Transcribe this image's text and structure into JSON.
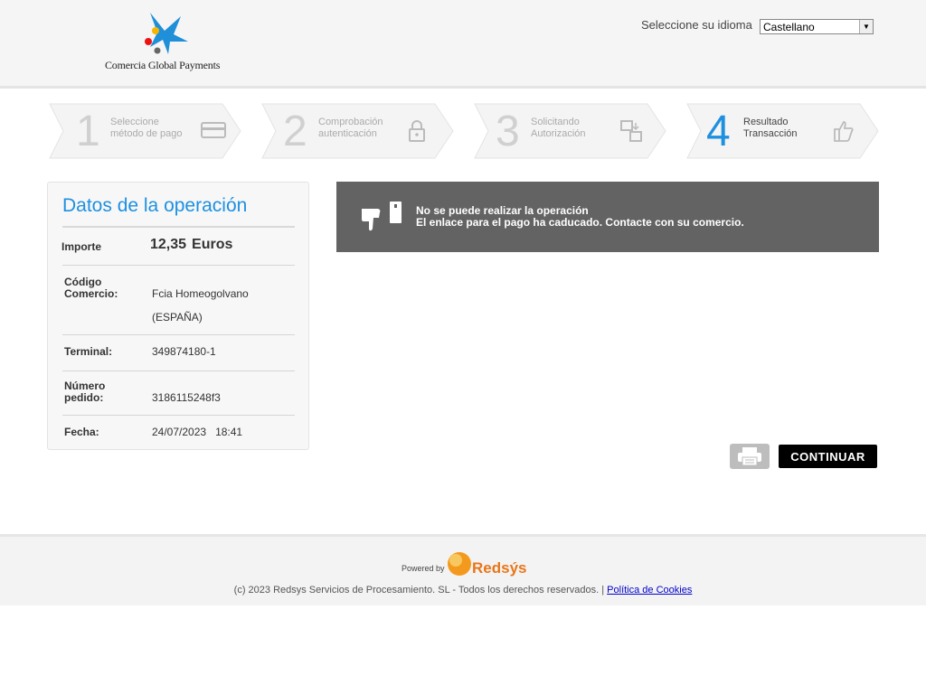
{
  "header": {
    "logo_text": "Comercia Global Payments",
    "language_label": "Seleccione su idioma",
    "language_selected": "Castellano"
  },
  "steps": [
    {
      "number": "1",
      "line1": "Seleccione",
      "line2": "método de pago",
      "icon": "card-icon"
    },
    {
      "number": "2",
      "line1": "Comprobación",
      "line2": "autenticación",
      "icon": "lock-icon"
    },
    {
      "number": "3",
      "line1": "Solicitando",
      "line2": "Autorización",
      "icon": "transfer-icon"
    },
    {
      "number": "4",
      "line1": "Resultado",
      "line2": "Transacción",
      "icon": "thumbs-up-icon"
    }
  ],
  "active_step": 4,
  "operation": {
    "title": "Datos de la operación",
    "importe_label": "Importe",
    "importe_amount": "12,35",
    "importe_currency": "Euros",
    "codigo_label_1": "Código",
    "codigo_label_2": "Comercio:",
    "codigo_value_1": "Fcia Homeogolvano",
    "codigo_value_2": "(ESPAÑA)",
    "terminal_label": "Terminal:",
    "terminal_value": "349874180-1",
    "pedido_label_1": "Número",
    "pedido_label_2": "pedido:",
    "pedido_value": "3186115248f3",
    "fecha_label": "Fecha:",
    "fecha_date": "24/07/2023",
    "fecha_time": "18:41"
  },
  "message": {
    "line1": "No se puede realizar la operación",
    "line2": "El enlace para el pago ha caducado. Contacte con su comercio.",
    "icon": "thumbs-down-icon"
  },
  "actions": {
    "print_icon": "printer-icon",
    "continue_label": "CONTINUAR"
  },
  "footer": {
    "powered_by": "Powered by",
    "brand": "Redsýs",
    "copyright": "(c) 2023 Redsys Servicios de Procesamiento. SL - Todos los derechos reservados. |",
    "cookies_link": "Política de Cookies"
  },
  "colors": {
    "accent_blue": "#1e90e0",
    "message_bg": "#636363",
    "redsys_orange": "#e8761a"
  }
}
